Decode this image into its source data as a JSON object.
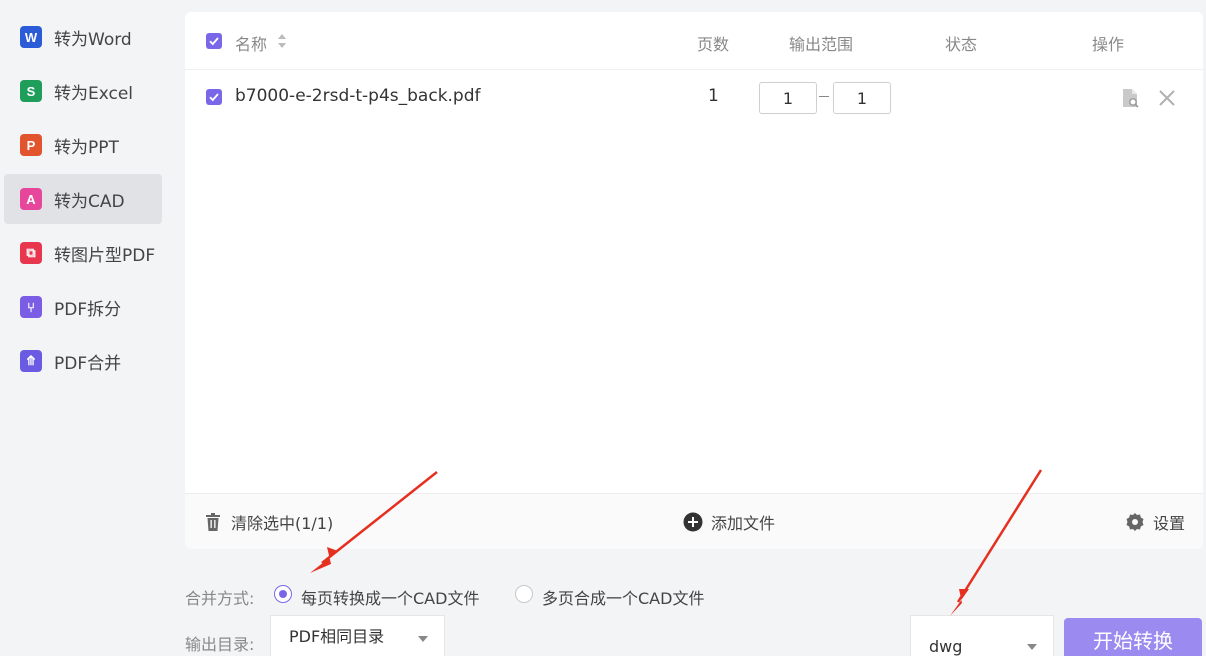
{
  "sidebar": {
    "items": [
      {
        "label": "转为Word",
        "icon": "word-icon",
        "glyph": "W",
        "color": "#2b5bd7",
        "active": false
      },
      {
        "label": "转为Excel",
        "icon": "excel-icon",
        "glyph": "S",
        "color": "#1e9e5a",
        "active": false
      },
      {
        "label": "转为PPT",
        "icon": "ppt-icon",
        "glyph": "P",
        "color": "#e2542e",
        "active": false
      },
      {
        "label": "转为CAD",
        "icon": "cad-icon",
        "glyph": "A",
        "color": "#e6479a",
        "active": true
      },
      {
        "label": "转图片型PDF",
        "icon": "image-pdf-icon",
        "glyph": "⧉",
        "color": "#e8364f",
        "active": false
      },
      {
        "label": "PDF拆分",
        "icon": "split-icon",
        "glyph": "⑂",
        "color": "#7b5ce5",
        "active": false
      },
      {
        "label": "PDF合并",
        "icon": "merge-icon",
        "glyph": "⤊",
        "color": "#6a5be2",
        "active": false
      }
    ]
  },
  "table": {
    "headers": {
      "name": "名称",
      "pages": "页数",
      "range": "输出范围",
      "status": "状态",
      "actions": "操作"
    },
    "rows": [
      {
        "name": "b7000-e-2rsd-t-p4s_back.pdf",
        "pages": "1",
        "range_from": "1",
        "range_to": "1",
        "status": ""
      }
    ]
  },
  "footer": {
    "clear_label": "清除选中(1/1)",
    "add_label": "添加文件",
    "settings_label": "设置"
  },
  "options": {
    "merge_label": "合并方式:",
    "merge_option_1": "每页转换成一个CAD文件",
    "merge_option_2": "多页合成一个CAD文件",
    "output_label": "输出目录:",
    "output_value": "PDF相同目录",
    "format_value": "dwg",
    "start_label": "开始转换"
  },
  "colors": {
    "accent": "#7a67e8",
    "start_button": "#9b8bf0",
    "annotation_arrow": "#e53020"
  }
}
